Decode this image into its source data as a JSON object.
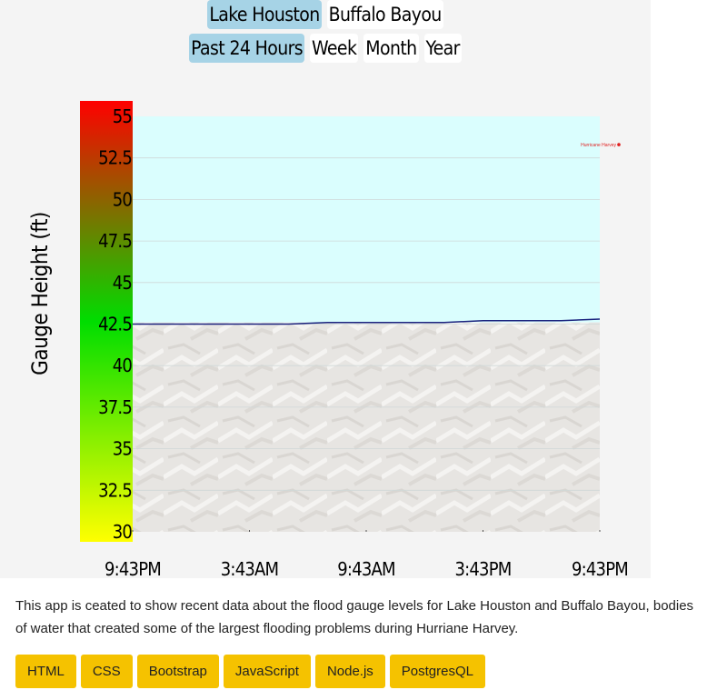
{
  "nav": {
    "locations": [
      {
        "label": "Lake Houston",
        "active": true
      },
      {
        "label": "Buffalo Bayou",
        "active": false
      }
    ],
    "ranges": [
      {
        "label": "Past 24 Hours",
        "active": true
      },
      {
        "label": "Week",
        "active": false
      },
      {
        "label": "Month",
        "active": false
      },
      {
        "label": "Year",
        "active": false
      }
    ]
  },
  "description": "This app is ceated to show recent data about the flood gauge levels for Lake Houston and Buffalo Bayou, bodies of water that created some of the largest flooding problems during Hurriane Harvey.",
  "tech_badges": [
    "HTML",
    "CSS",
    "Bootstrap",
    "JavaScript",
    "Node.js",
    "PostgresQL"
  ],
  "colors": {
    "water": "#dafefe",
    "badge": "#f5c200",
    "active_pill": "#a6d3e6",
    "series_line": "#1a237e",
    "annotation": "#e02020",
    "gradient": [
      "#ff0000",
      "#00dd00",
      "#ffff00"
    ]
  },
  "chart_data": {
    "type": "line",
    "ylabel": "Gauge Height (ft)",
    "xlabel": "",
    "ylim": [
      30,
      55
    ],
    "y_ticks": [
      "30",
      "32.5",
      "35",
      "37.5",
      "40",
      "42.5",
      "45",
      "47.5",
      "50",
      "52.5",
      "55"
    ],
    "x_tick_labels": [
      "9:43PM",
      "3:43AM",
      "9:43AM",
      "3:43PM",
      "9:43PM"
    ],
    "series": [
      {
        "values": [
          42.5,
          42.5,
          42.5,
          42.5,
          42.5,
          42.6,
          42.6,
          42.6,
          42.6,
          42.7,
          42.7,
          42.7,
          42.8
        ]
      }
    ],
    "annotation": {
      "label": "Hurricane Harvey",
      "value": 53.3
    },
    "grid": true
  }
}
